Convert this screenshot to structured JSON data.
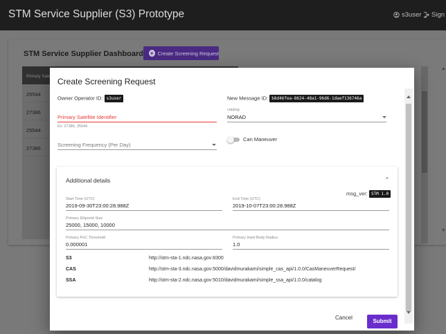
{
  "app": {
    "title": "STM Service Supplier (S3) Prototype",
    "username": "s3user",
    "signout_label": "Sign O"
  },
  "dashboard": {
    "title": "STM Service Supplier Dashboard",
    "create_button_label": "Create Screening Request",
    "table": {
      "header": "Primary Sate",
      "rows": [
        "25544",
        "27386",
        "25544",
        "27386"
      ]
    }
  },
  "modal": {
    "title": "Create Screening Request",
    "owner_operator_label": "Owner Operator ID:",
    "owner_operator_value": "s3user",
    "new_message_label": "New Message ID:",
    "new_message_value": "b8d46fea-8624-48a1-96d6-1daef136746a",
    "primary_satellite": {
      "label": "Primary Satellite Identifier",
      "helper": "Ex: 27386, 25544"
    },
    "catalog": {
      "label": "catalog",
      "value": "NORAD"
    },
    "screening_frequency": {
      "label": "Screening Frequency (Per Day)"
    },
    "can_maneuver": {
      "label": "Can Maneuver",
      "checked": false
    },
    "additional_details": {
      "title": "Additional details",
      "msg_ver_label": "msg_ver:",
      "msg_ver_value": "STM 1.0",
      "start_time_label": "Start Time (UTC)",
      "start_time_value": "2019-09-30T23:00:28.988Z",
      "end_time_label": "End Time (UTC)",
      "end_time_value": "2019-10-07T23:00:28.988Z",
      "ellipsoid_label": "Primary Ellipsoid Size",
      "ellipsoid_value": "25000, 15000, 10000",
      "poc_label": "Primary PoC Threshold",
      "poc_value": "0.000001",
      "hbr_label": "Primary Hard Body Radius",
      "hbr_value": "1.0",
      "endpoints": [
        {
          "name": "S3",
          "url": "http://stm-sta-1.ndc.nasa.gov:8300"
        },
        {
          "name": "CAS",
          "url": "http://stm-sta-3.ndc.nasa.gov:5000/davidmurakami/simple_cas_api/1.0.0/CasManeuverRequest/"
        },
        {
          "name": "SSA",
          "url": "http://stm-sta-2.ndc.nasa.gov:5010/davidmurakami/simple_ssa_api/1.0.0/catalog"
        }
      ]
    },
    "cancel_label": "Cancel",
    "submit_label": "Submit"
  },
  "colors": {
    "accent": "#6a2dcc",
    "error": "#e53935",
    "appbar": "#1e1e1e"
  }
}
